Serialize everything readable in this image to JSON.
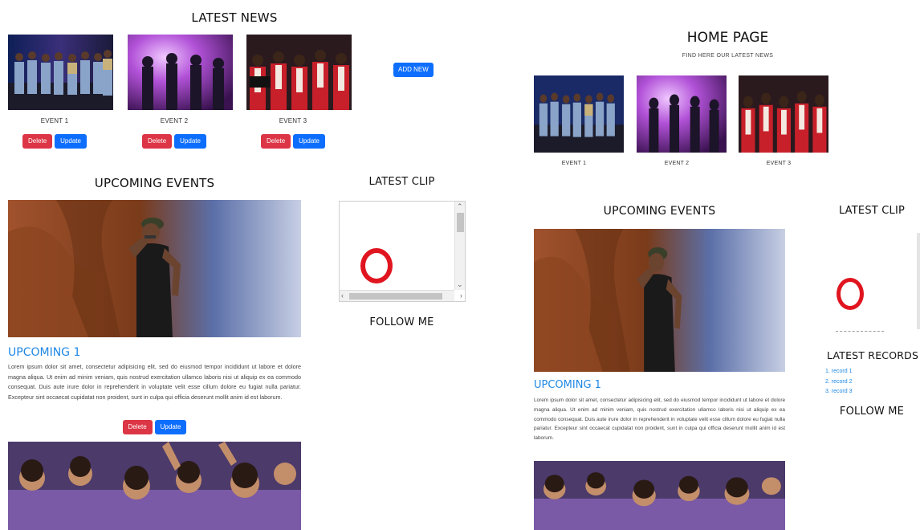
{
  "left": {
    "latest_news_title": "LATEST NEWS",
    "events": [
      {
        "caption": "EVENT 1",
        "delete_label": "Delete",
        "update_label": "Update"
      },
      {
        "caption": "EVENT 2",
        "delete_label": "Delete",
        "update_label": "Update"
      },
      {
        "caption": "EVENT 3",
        "delete_label": "Delete",
        "update_label": "Update"
      }
    ],
    "add_new_label": "ADD NEW",
    "upcoming_events_title": "UPCOMING EVENTS",
    "latest_clip_title": "LATEST CLIP",
    "follow_me_title": "FOLLOW ME",
    "upcoming_1": {
      "heading": "UPCOMING 1",
      "body": "Lorem ipsum dolor sit amet, consectetur adipisicing elit, sed do eiusmod tempor incididunt ut labore et dolore magna aliqua. Ut enim ad minim veniam, quis nostrud exercitation ullamco laboris nisi ut aliquip ex ea commodo consequat. Duis aute irure dolor in reprehenderit in voluptate velit esse cillum dolore eu fugiat nulla pariatur. Excepteur sint occaecat cupidatat non proident, sunt in culpa qui officia deserunt mollit anim id est laborum.",
      "delete_label": "Delete",
      "update_label": "Update"
    }
  },
  "right": {
    "home_title": "HOME PAGE",
    "home_subtitle": "FIND HERE OUR LATEST NEWS",
    "events": [
      {
        "caption": "EVENT 1"
      },
      {
        "caption": "EVENT 2"
      },
      {
        "caption": "EVENT 3"
      }
    ],
    "upcoming_events_title": "UPCOMING EVENTS",
    "latest_clip_title": "LATEST CLIP",
    "latest_records_title": "LATEST RECORDS",
    "records": [
      "1. record 1",
      "2. record 2",
      "3. record 3"
    ],
    "follow_me_title": "FOLLOW ME",
    "upcoming_1": {
      "heading": "UPCOMING 1",
      "body": "Lorem ipsum dolor sit amet, consectetur adipisicing elit, sed do eiusmod tempor incididunt ut labore et dolore magna aliqua. Ut enim ad minim veniam, quis nostrud exercitation ullamco laboris nisi ut aliquip ex ea commodo consequat. Duis aute irure dolor in reprehenderit in voluptate velit esse cillum dolore eu fugiat nulla pariatur. Excepteur sint occaecat cupidatat non proident, sunt in culpa qui officia deserunt mollit anim id est laborum."
    }
  },
  "colors": {
    "danger": "#dc3545",
    "primary": "#0d6efd",
    "link": "#1e88e5",
    "opera_red": "#e0151f"
  }
}
